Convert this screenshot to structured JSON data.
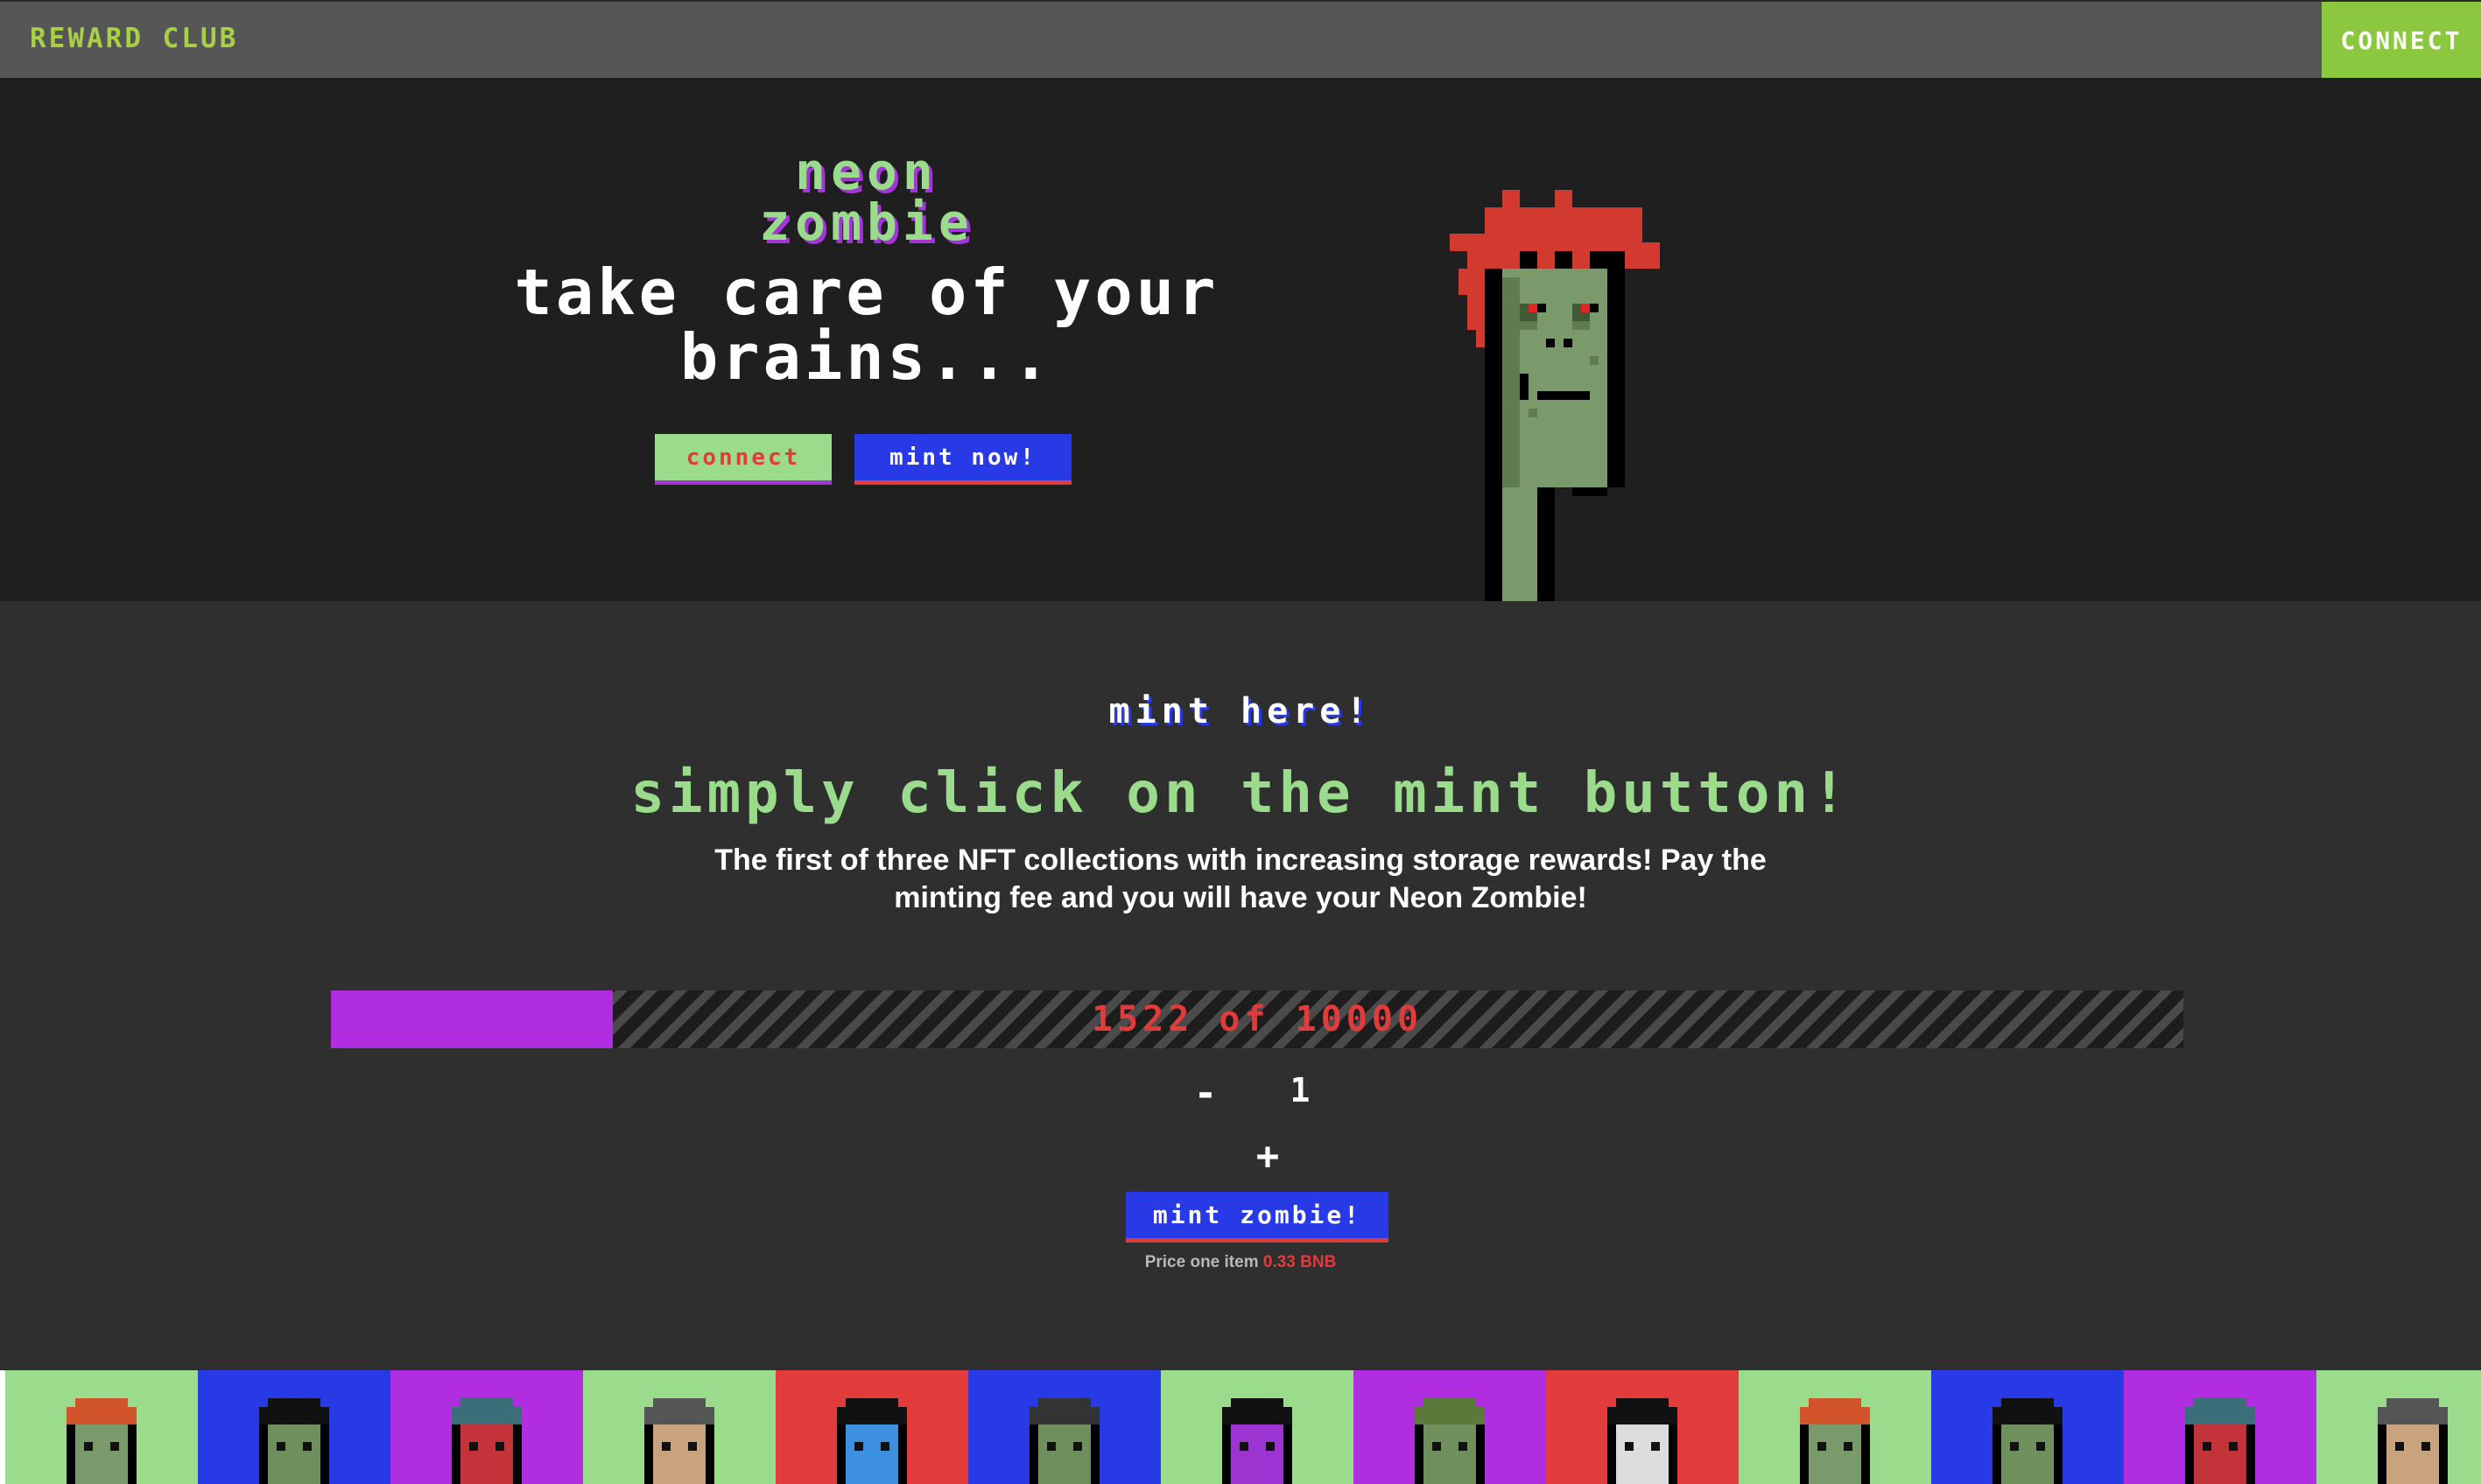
{
  "nav": {
    "brand": "REWARD CLUB",
    "connect_label": "CONNECT"
  },
  "hero": {
    "title_line1": "NEON",
    "title_line2": "ZOMBIE",
    "subtitle": "Take care of your brains...",
    "connect_label": "connect",
    "mint_now_label": "mint now!"
  },
  "mint": {
    "heading": "mint here!",
    "lead": "Simply click on the mint button!",
    "description": "The first of three NFT collections with increasing storage rewards! Pay the minting fee and you will have your Neon Zombie!",
    "progress": {
      "minted": 1522,
      "total": 10000,
      "label": "1522 of 10000"
    },
    "minus_label": "-",
    "quantity": "1",
    "plus_label": "+",
    "mint_button_label": "mint zombie!",
    "price_label": "Price one item",
    "price_value": "0.33 BNB"
  },
  "colors": {
    "accent_green": "#9bdc8c",
    "accent_blue": "#2839e6",
    "accent_purple": "#b02ee0",
    "accent_red": "#e13b3b",
    "nav_green": "#8bc83f"
  },
  "gallery": {
    "tiles": [
      {
        "bg": "#9bdc8c",
        "hair": "#d2542a",
        "skin": "#7b9a6b"
      },
      {
        "bg": "#2839e6",
        "hair": "#111111",
        "skin": "#6f8f5d"
      },
      {
        "bg": "#b02ee0",
        "hair": "#3a6f7a",
        "skin": "#c4323a"
      },
      {
        "bg": "#9bdc8c",
        "hair": "#555555",
        "skin": "#c9a27e"
      },
      {
        "bg": "#e13b3b",
        "hair": "#111111",
        "skin": "#3d8fe0"
      },
      {
        "bg": "#2839e6",
        "hair": "#333333",
        "skin": "#6f8f5d"
      },
      {
        "bg": "#9bdc8c",
        "hair": "#111111",
        "skin": "#9b34d0"
      },
      {
        "bg": "#b02ee0",
        "hair": "#5b7a3a",
        "skin": "#6f8f5d"
      },
      {
        "bg": "#e13b3b",
        "hair": "#111111",
        "skin": "#dddddd"
      },
      {
        "bg": "#9bdc8c",
        "hair": "#d2542a",
        "skin": "#7b9a6b"
      },
      {
        "bg": "#2839e6",
        "hair": "#111111",
        "skin": "#6f8f5d"
      },
      {
        "bg": "#b02ee0",
        "hair": "#3a6f7a",
        "skin": "#c4323a"
      },
      {
        "bg": "#9bdc8c",
        "hair": "#555555",
        "skin": "#c9a27e"
      }
    ]
  }
}
